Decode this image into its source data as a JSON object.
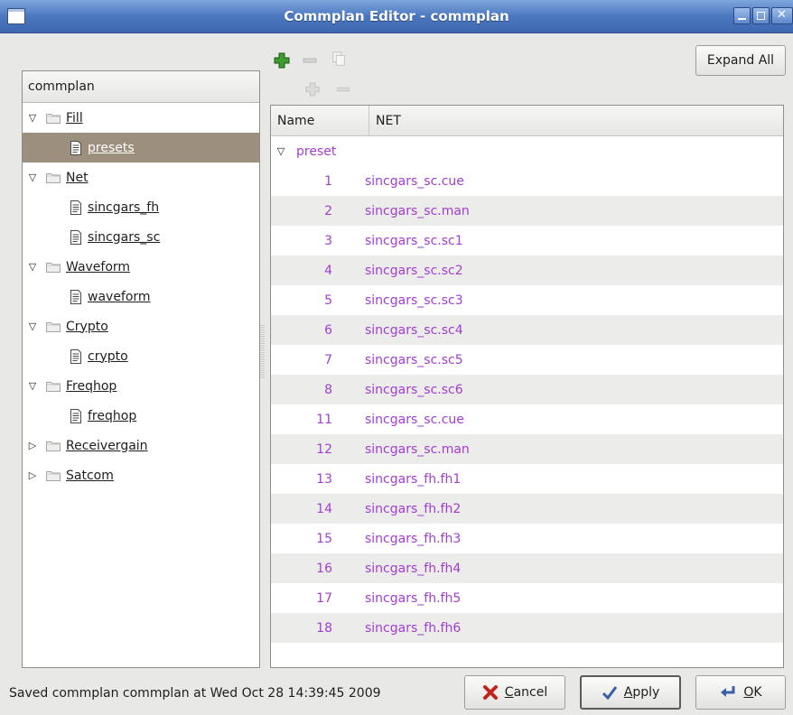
{
  "window": {
    "title": "Commplan Editor - commplan"
  },
  "toolbar": {
    "expand_all_label": "Expand All"
  },
  "tree": {
    "header": "commplan",
    "items": [
      {
        "label": "Fill",
        "level": 0,
        "type": "folder",
        "expanded": true
      },
      {
        "label": "presets",
        "level": 1,
        "type": "file",
        "selected": true
      },
      {
        "label": "Net",
        "level": 0,
        "type": "folder",
        "expanded": true
      },
      {
        "label": "sincgars_fh",
        "level": 1,
        "type": "file"
      },
      {
        "label": "sincgars_sc",
        "level": 1,
        "type": "file"
      },
      {
        "label": "Waveform",
        "level": 0,
        "type": "folder",
        "expanded": true
      },
      {
        "label": "waveform",
        "level": 1,
        "type": "file"
      },
      {
        "label": "Crypto",
        "level": 0,
        "type": "folder",
        "expanded": true
      },
      {
        "label": "crypto",
        "level": 1,
        "type": "file"
      },
      {
        "label": "Freqhop",
        "level": 0,
        "type": "folder",
        "expanded": true
      },
      {
        "label": "freqhop",
        "level": 1,
        "type": "file"
      },
      {
        "label": "Receivergain",
        "level": 0,
        "type": "folder",
        "expanded": false
      },
      {
        "label": "Satcom",
        "level": 0,
        "type": "folder",
        "expanded": false
      }
    ]
  },
  "table": {
    "columns": [
      "Name",
      "NET"
    ],
    "group": "preset",
    "rows": [
      {
        "name": "1",
        "net": "sincgars_sc.cue"
      },
      {
        "name": "2",
        "net": "sincgars_sc.man"
      },
      {
        "name": "3",
        "net": "sincgars_sc.sc1"
      },
      {
        "name": "4",
        "net": "sincgars_sc.sc2"
      },
      {
        "name": "5",
        "net": "sincgars_sc.sc3"
      },
      {
        "name": "6",
        "net": "sincgars_sc.sc4"
      },
      {
        "name": "7",
        "net": "sincgars_sc.sc5"
      },
      {
        "name": "8",
        "net": "sincgars_sc.sc6"
      },
      {
        "name": "11",
        "net": "sincgars_sc.cue"
      },
      {
        "name": "12",
        "net": "sincgars_sc.man"
      },
      {
        "name": "13",
        "net": "sincgars_fh.fh1"
      },
      {
        "name": "14",
        "net": "sincgars_fh.fh2"
      },
      {
        "name": "15",
        "net": "sincgars_fh.fh3"
      },
      {
        "name": "16",
        "net": "sincgars_fh.fh4"
      },
      {
        "name": "17",
        "net": "sincgars_fh.fh5"
      },
      {
        "name": "18",
        "net": "sincgars_fh.fh6"
      }
    ]
  },
  "status": "Saved commplan commplan at Wed Oct 28 14:39:45 2009",
  "buttons": {
    "cancel_mnemonic": "C",
    "cancel_rest": "ancel",
    "apply_mnemonic": "A",
    "apply_rest": "pply",
    "ok_mnemonic": "O",
    "ok_rest": "K"
  },
  "colors": {
    "titlebar": "#4b77c0",
    "selection": "#9c8f7d",
    "table_text": "#a23ecf"
  }
}
